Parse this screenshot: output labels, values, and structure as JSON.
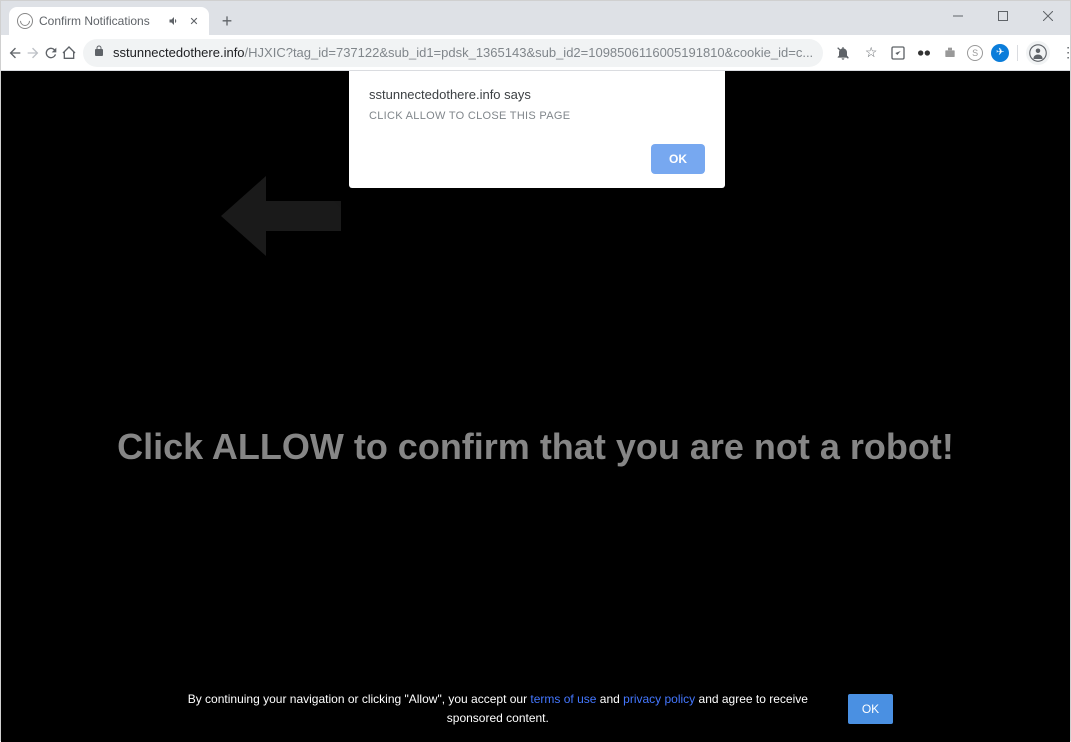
{
  "window": {
    "tab_title": "Confirm Notifications"
  },
  "address": {
    "domain": "sstunnectedothere.info",
    "path": "/HJXIC?tag_id=737122&sub_id1=pdsk_1365143&sub_id2=1098506116005191810&cookie_id=c..."
  },
  "alert": {
    "title_domain": "sstunnectedothere.info says",
    "message": "CLICK ALLOW TO CLOSE THIS PAGE",
    "ok": "OK"
  },
  "page": {
    "headline": "Click ALLOW to confirm that you are not a robot!"
  },
  "footer": {
    "pre": "By continuing your navigation or clicking \"Allow\", you accept our ",
    "terms": "terms of use",
    "and": " and ",
    "privacy": "privacy policy",
    "post": " and agree to receive sponsored content.",
    "ok": "OK"
  }
}
